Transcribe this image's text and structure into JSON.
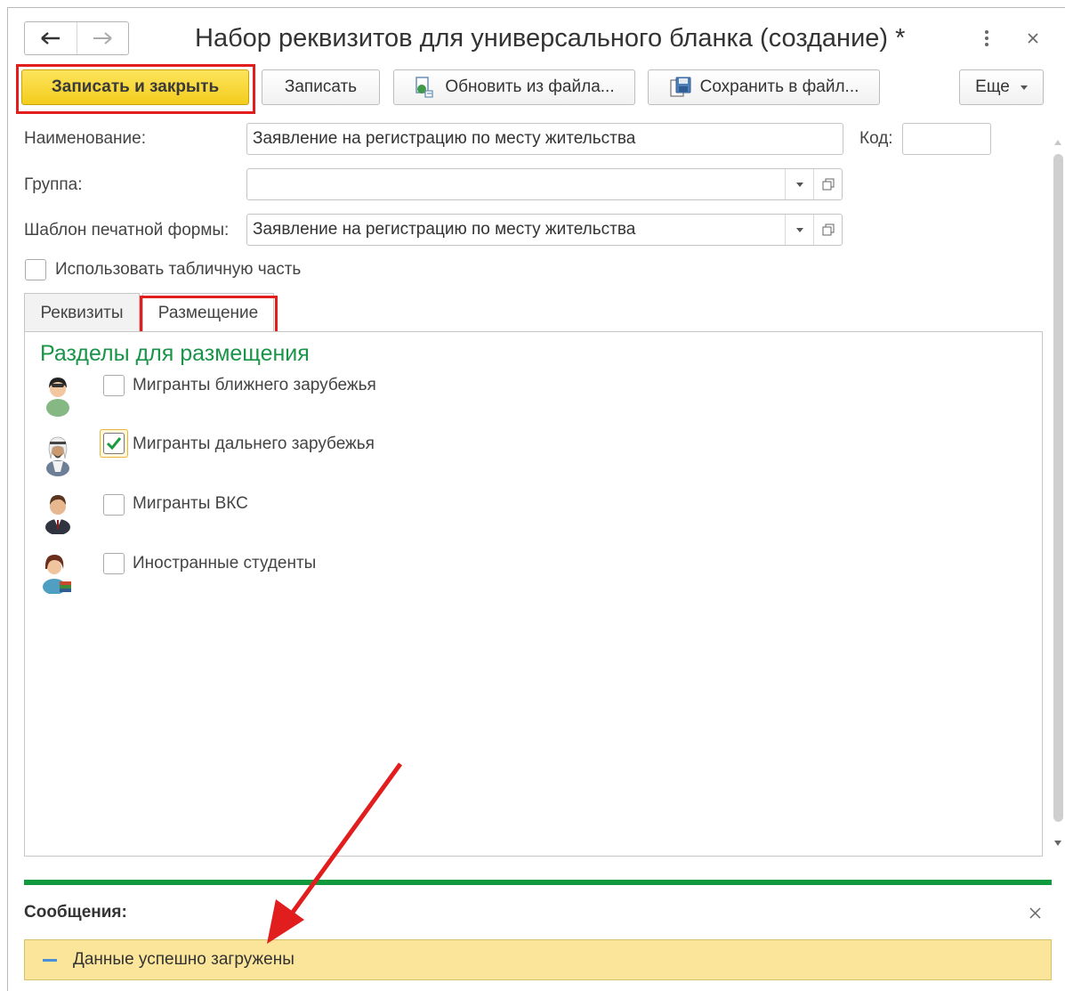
{
  "window": {
    "title": "Набор реквизитов для универсального бланка (создание) *",
    "more_icon": "vertical-dots-icon",
    "close_icon": "close-icon"
  },
  "nav": {
    "back_icon": "arrow-left-icon",
    "forward_icon": "arrow-right-icon"
  },
  "toolbar": {
    "save_close_label": "Записать и закрыть",
    "save_label": "Записать",
    "update_from_file_label": "Обновить из файла...",
    "save_to_file_label": "Сохранить в файл...",
    "more_label": "Еще"
  },
  "form": {
    "name_label": "Наименование:",
    "name_value": "Заявление на регистрацию по месту жительства",
    "code_label": "Код:",
    "code_value": "",
    "group_label": "Группа:",
    "group_value": "",
    "template_label": "Шаблон печатной формы:",
    "template_value": "Заявление на регистрацию по месту жительства",
    "use_table_label": "Использовать табличную часть",
    "use_table_checked": false
  },
  "tabs": [
    {
      "label": "Реквизиты",
      "active": false
    },
    {
      "label": "Размещение",
      "active": true
    }
  ],
  "placement": {
    "section_title": "Разделы для размещения",
    "items": [
      {
        "label": "Мигранты ближнего зарубежья",
        "checked": false,
        "icon": "migrant-near-icon"
      },
      {
        "label": "Мигранты дальнего зарубежья",
        "checked": true,
        "icon": "migrant-far-icon"
      },
      {
        "label": "Мигранты ВКС",
        "checked": false,
        "icon": "migrant-hqs-icon"
      },
      {
        "label": "Иностранные студенты",
        "checked": false,
        "icon": "foreign-student-icon"
      }
    ]
  },
  "messages": {
    "title": "Сообщения:",
    "items": [
      {
        "text": "Данные успешно загружены"
      }
    ]
  },
  "colors": {
    "primary_button": "#f3cc1c",
    "section_title": "#1a9448",
    "highlight": "#e21d1d",
    "message_bg": "#fbe59a",
    "divider": "#11993d"
  }
}
